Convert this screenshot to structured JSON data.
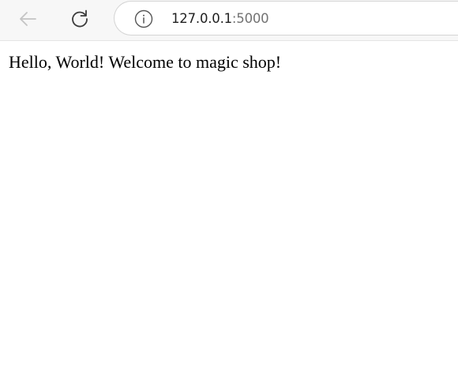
{
  "browser": {
    "toolbar": {
      "back_icon": "arrow-left-icon",
      "reload_icon": "reload-icon",
      "back_enabled": false
    },
    "address_bar": {
      "info_icon": "info-circle-icon",
      "url_host": "127.0.0.1",
      "url_port": ":5000"
    }
  },
  "page": {
    "body_text": "Hello, World! Welcome to magic shop!"
  },
  "colors": {
    "toolbar_bg": "#f7f7f7",
    "icon_disabled": "#c4c4c4",
    "icon_active": "#3c3c3c",
    "url_host": "#1f1f1f",
    "url_port": "#737373"
  }
}
